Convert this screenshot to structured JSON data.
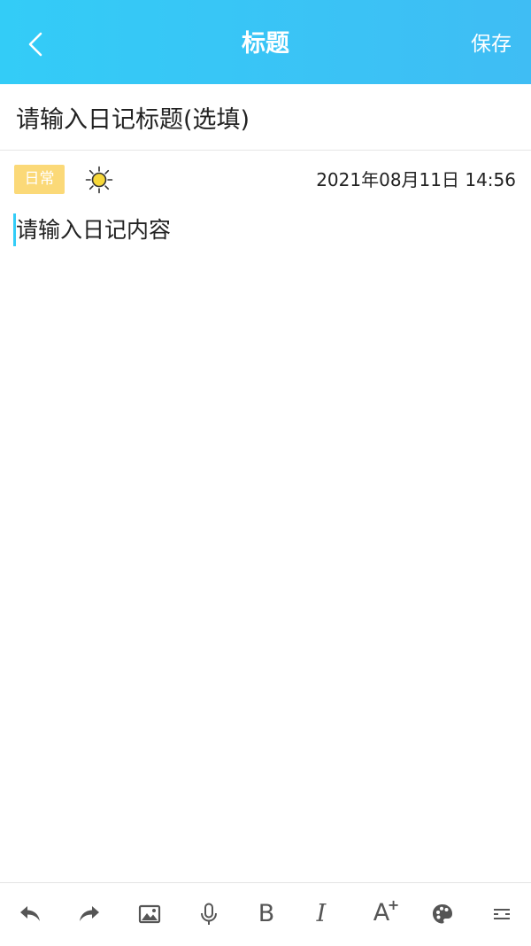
{
  "header": {
    "title": "标题",
    "save_label": "保存",
    "back_icon": "chevron-left-icon"
  },
  "editor": {
    "title_placeholder": "请输入日记标题(选填)",
    "content_placeholder": "请输入日记内容"
  },
  "meta": {
    "tag": "日常",
    "weather_icon": "sun-icon",
    "datetime": "2021年08月11日 14:56"
  },
  "toolbar": {
    "bold_label": "B",
    "italic_label": "I",
    "font_size_label": "A",
    "font_size_sup": "+",
    "icons": [
      "undo-icon",
      "redo-icon",
      "image-icon",
      "microphone-icon",
      "bold-icon",
      "italic-icon",
      "font-size-icon",
      "palette-icon",
      "more-icon"
    ]
  },
  "colors": {
    "header_bg": "#33ccf7",
    "tag_bg": "#fbd978",
    "caret": "#33ccf7",
    "icon": "#555555"
  }
}
